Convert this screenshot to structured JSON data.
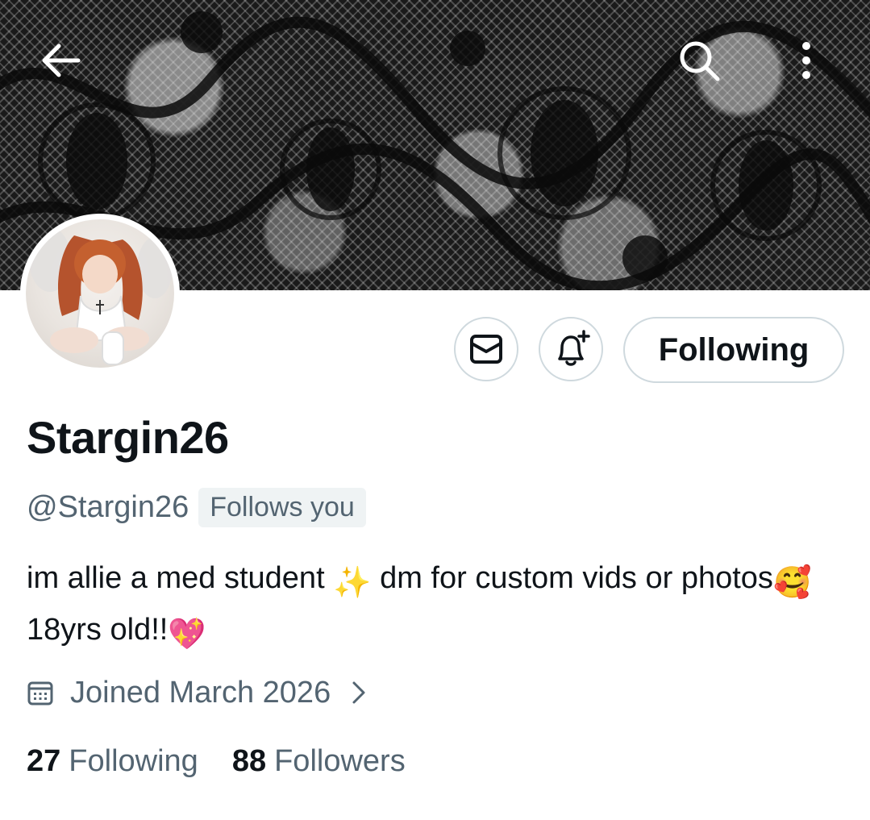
{
  "header": {
    "back_icon": "arrow-left-icon",
    "search_icon": "search-icon",
    "more_icon": "more-vertical-icon"
  },
  "profile": {
    "display_name": "Stargin26",
    "handle": "@Stargin26",
    "follows_you": "Follows you",
    "bio": {
      "part1": "im allie a med student ",
      "part2": " dm for custom vids or photos",
      "part3": " 18yrs old!!",
      "emoji1": "✨",
      "emoji2": "🥰",
      "emoji3": "💖"
    },
    "joined": "Joined March 2026"
  },
  "actions": {
    "message_icon": "envelope-icon",
    "notify_icon": "bell-plus-icon",
    "follow_label": "Following"
  },
  "stats": {
    "following_count": "27",
    "following_label": "Following",
    "followers_count": "88",
    "followers_label": "Followers"
  },
  "colors": {
    "text_primary": "#0f1419",
    "text_secondary": "#536471",
    "border": "#cfd9de",
    "badge_bg": "#eff3f4"
  }
}
